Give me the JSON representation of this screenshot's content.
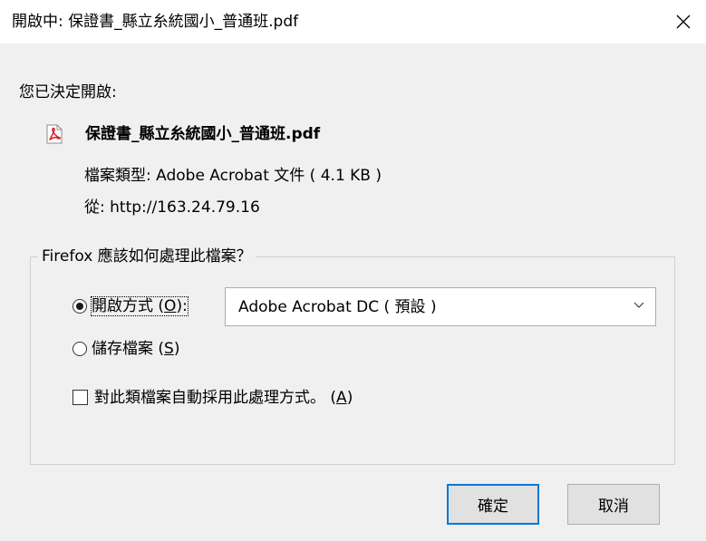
{
  "window": {
    "title": "開啟中: 保證書_縣立糸統國小_普通班.pdf",
    "close_symbol": "✕"
  },
  "info": {
    "decided_label": "您已決定開啟:",
    "file_icon": "pdf-file-icon",
    "file_name": "保證書_縣立糸統國小_普通班.pdf",
    "file_type": "檔案類型: Adobe Acrobat 文件 ( 4.1 KB )",
    "from": "從: http://163.24.79.16"
  },
  "action_group": {
    "legend": "Firefox 應該如何處理此檔案？",
    "open_with": {
      "label": "開啟方式 (",
      "accesskey": "O",
      "label_end": "):",
      "selected": true
    },
    "app_select": {
      "value": "Adobe Acrobat DC ( 預設 )",
      "icon": "chevron-down-icon"
    },
    "save_file": {
      "label": "儲存檔案 (",
      "accesskey": "S",
      "label_end": ")",
      "selected": false
    },
    "remember": {
      "label": "對此類檔案自動採用此處理方式。 (",
      "accesskey": "A",
      "label_end": ")",
      "checked": false
    }
  },
  "buttons": {
    "ok": "確定",
    "cancel": "取消"
  },
  "colors": {
    "dialog_bg": "#f0f0f0",
    "titlebar_bg": "#ffffff",
    "accent": "#0078d7",
    "pdf_red": "#d9232d"
  }
}
